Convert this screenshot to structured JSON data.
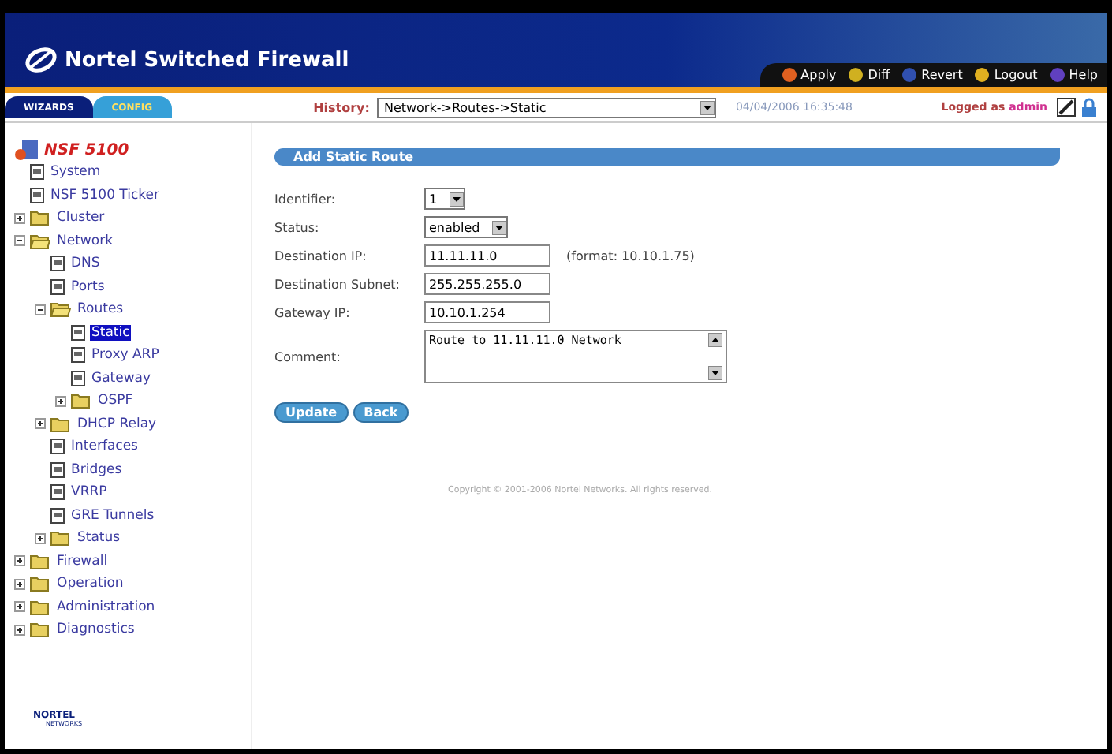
{
  "header": {
    "title": "Nortel Switched Firewall",
    "actions": [
      {
        "label": "Apply"
      },
      {
        "label": "Diff"
      },
      {
        "label": "Revert"
      },
      {
        "label": "Logout"
      },
      {
        "label": "Help"
      }
    ]
  },
  "tabs": [
    {
      "label": "WIZARDS",
      "selected": false
    },
    {
      "label": "CONFIG",
      "selected": true
    }
  ],
  "history": {
    "label": "History:",
    "value": "Network->Routes->Static"
  },
  "timestamp": "04/04/2006 16:35:48",
  "login": {
    "label": "Logged as",
    "user": "admin"
  },
  "tree": {
    "root": "NSF 5100",
    "items": [
      {
        "label": "System",
        "kind": "page",
        "selected": false
      },
      {
        "label": "NSF 5100 Ticker",
        "kind": "page",
        "selected": false
      },
      {
        "label": "Cluster",
        "kind": "folder",
        "expanded": false,
        "selected": false
      },
      {
        "label": "Network",
        "kind": "folder",
        "expanded": true,
        "selected": false,
        "children": [
          {
            "label": "DNS",
            "kind": "page",
            "selected": false
          },
          {
            "label": "Ports",
            "kind": "page",
            "selected": false
          },
          {
            "label": "Routes",
            "kind": "folder",
            "expanded": true,
            "selected": false,
            "children": [
              {
                "label": "Static",
                "kind": "page",
                "selected": true
              },
              {
                "label": "Proxy ARP",
                "kind": "page",
                "selected": false
              },
              {
                "label": "Gateway",
                "kind": "page",
                "selected": false
              },
              {
                "label": "OSPF",
                "kind": "folder",
                "expanded": false,
                "selected": false
              }
            ]
          },
          {
            "label": "DHCP Relay",
            "kind": "folder",
            "expanded": false,
            "selected": false
          },
          {
            "label": "Interfaces",
            "kind": "page",
            "selected": false
          },
          {
            "label": "Bridges",
            "kind": "page",
            "selected": false
          },
          {
            "label": "VRRP",
            "kind": "page",
            "selected": false
          },
          {
            "label": "GRE Tunnels",
            "kind": "page",
            "selected": false
          },
          {
            "label": "Status",
            "kind": "folder",
            "expanded": false,
            "selected": false
          }
        ]
      },
      {
        "label": "Firewall",
        "kind": "folder",
        "expanded": false,
        "selected": false
      },
      {
        "label": "Operation",
        "kind": "folder",
        "expanded": false,
        "selected": false
      },
      {
        "label": "Administration",
        "kind": "folder",
        "expanded": false,
        "selected": false
      },
      {
        "label": "Diagnostics",
        "kind": "folder",
        "expanded": false,
        "selected": false
      }
    ]
  },
  "sidebar_logo": {
    "line_1": "NORTEL",
    "line_2": "NETWORKS"
  },
  "form": {
    "title": "Add Static Route",
    "fields": [
      {
        "label": "Identifier:",
        "kind": "select",
        "value": "1"
      },
      {
        "label": "Status:",
        "kind": "select",
        "value": "enabled"
      },
      {
        "label": "Destination IP:",
        "kind": "text",
        "value": "11.11.11.0",
        "hint": "(format: 10.10.1.75)"
      },
      {
        "label": "Destination Subnet:",
        "kind": "text",
        "value": "255.255.255.0"
      },
      {
        "label": "Gateway IP:",
        "kind": "text",
        "value": "10.10.1.254"
      },
      {
        "label": "Comment:",
        "kind": "textarea",
        "value": "Route to 11.11.11.0 Network"
      }
    ],
    "buttons": [
      "Update",
      "Back"
    ]
  },
  "copyright": "Copyright © 2001-2006 Nortel Networks. All rights reserved."
}
